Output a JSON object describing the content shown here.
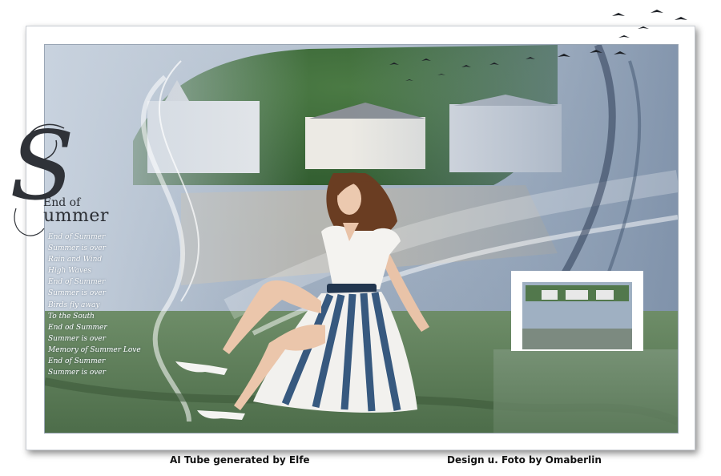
{
  "artwork": {
    "title_small": "End of",
    "title_initial": "S",
    "title_rest": "ummer",
    "poem_lines": [
      "End of Summer",
      "Summer is over",
      "Rain and Wind",
      "High Waves",
      "End of Summer",
      "Summer is over",
      "Birds fly away",
      "To the South",
      "End od Summer",
      "Summer is over",
      "Memory of Summer Love",
      "End of Summer",
      "Summer is over"
    ]
  },
  "credits": {
    "left": "AI Tube generated by Elfe",
    "right": "Design u. Foto by Omaberlin"
  },
  "colors": {
    "sky": "#9fb0c4",
    "forest": "#3f6a3a",
    "meadow": "#5f7f5a",
    "sea": "#6f8b6c",
    "dress_stripe": "#37597f"
  },
  "icons": [
    "bird-icon"
  ]
}
